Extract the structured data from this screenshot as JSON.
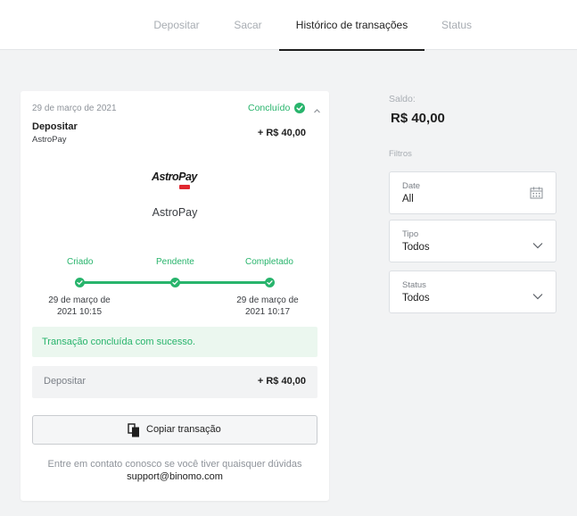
{
  "nav": {
    "tabs": [
      {
        "label": "Depositar"
      },
      {
        "label": "Sacar"
      },
      {
        "label": "Histórico de transações"
      },
      {
        "label": "Status"
      }
    ],
    "active_index": 2
  },
  "transaction": {
    "date": "29 de março de 2021",
    "status": "Concluído",
    "type": "Depositar",
    "method": "AstroPay",
    "amount": "+ R$ 40,00",
    "logo_text": "AstroPay",
    "provider_name": "AstroPay",
    "steps": [
      {
        "label": "Criado",
        "time_line1": "29 de março de",
        "time_line2": "2021 10:15"
      },
      {
        "label": "Pendente",
        "time_line1": "",
        "time_line2": ""
      },
      {
        "label": "Completado",
        "time_line1": "29 de março de",
        "time_line2": "2021 10:17"
      }
    ],
    "success_message": "Transação concluída com sucesso.",
    "summary_label": "Depositar",
    "summary_amount": "+ R$ 40,00",
    "copy_label": "Copiar transação",
    "contact_text": "Entre em contato conosco se você tiver quaisquer dúvidas",
    "support_email": "support@binomo.com"
  },
  "sidebar": {
    "balance_label": "Saldo:",
    "balance_value": "R$ 40,00",
    "filters_label": "Filtros",
    "filters": [
      {
        "label": "Date",
        "value": "All",
        "icon": "calendar-icon"
      },
      {
        "label": "Tipo",
        "value": "Todos",
        "icon": "chevron-down-icon"
      },
      {
        "label": "Status",
        "value": "Todos",
        "icon": "chevron-down-icon"
      }
    ]
  },
  "colors": {
    "success": "#28b46c",
    "success_bg": "#ebf7ef",
    "background": "#f2f3f4",
    "brand_red": "#e0262f"
  }
}
